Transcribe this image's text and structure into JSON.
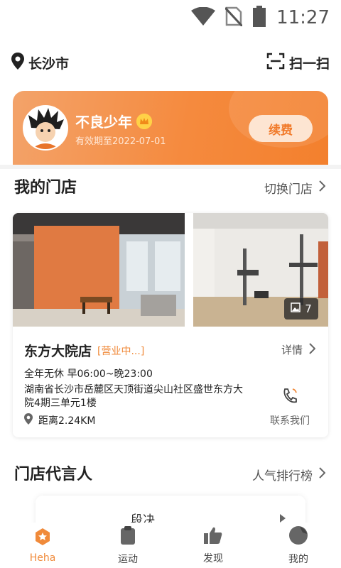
{
  "status": {
    "time": "11:27"
  },
  "location": {
    "city": "长沙市"
  },
  "scan": {
    "label": "扫一扫"
  },
  "member": {
    "name": "不良少年",
    "expiry": "有效期至2022-07-01",
    "renew_label": "续费"
  },
  "my_store": {
    "title": "我的门店",
    "switch_label": "切换门店"
  },
  "store": {
    "photo_count": "7",
    "name": "东方大院店",
    "status": "[营业中...]",
    "detail_label": "详情",
    "hours": "全年无休 早06:00~晚23:00",
    "address": "湖南省长沙市岳麓区天顶街道尖山社区盛世东方大院4期三单元1楼",
    "distance": "距离2.24KM",
    "contact_label": "联系我们"
  },
  "spokes": {
    "title": "门店代言人",
    "ranking_label": "人气排行榜",
    "peek_text": "段决"
  },
  "tabbar": {
    "items": [
      {
        "label": "Heha",
        "icon": "heha-icon",
        "active": true
      },
      {
        "label": "运动",
        "icon": "clipboard-icon",
        "active": false
      },
      {
        "label": "发现",
        "icon": "thumbs-up-icon",
        "active": false
      },
      {
        "label": "我的",
        "icon": "user-icon",
        "active": false
      }
    ]
  },
  "colors": {
    "accent": "#f08a3a",
    "card_gradient_start": "#f3a36a",
    "card_gradient_end": "#f3802d"
  }
}
